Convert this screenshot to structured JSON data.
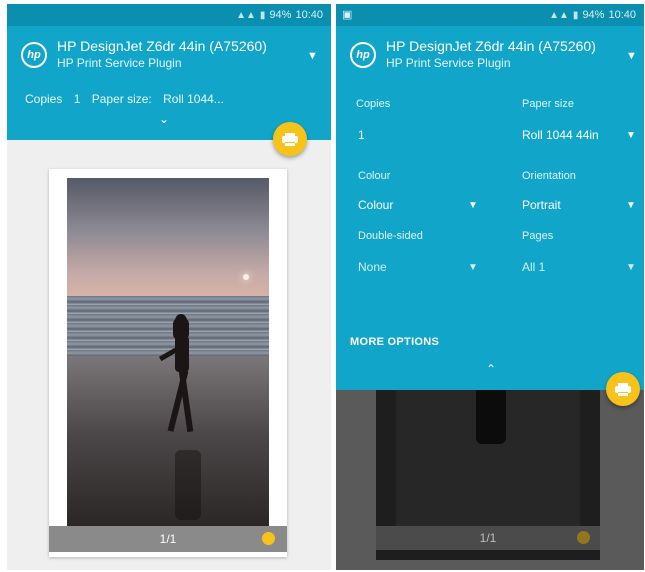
{
  "status_bar": {
    "time": "10:40",
    "battery": "94%"
  },
  "printer": {
    "name": "HP DesignJet Z6dr 44in (A75260)",
    "service": "HP Print Service Plugin",
    "logo_text": "hp"
  },
  "summary": {
    "copies_label": "Copies",
    "copies_value": "1",
    "paper_label": "Paper size:",
    "paper_value": "Roll 1044..."
  },
  "options": {
    "copies": {
      "label": "Copies",
      "value": "1"
    },
    "paper_size": {
      "label": "Paper size",
      "value": "Roll 1044 44in"
    },
    "colour": {
      "label": "Colour",
      "value": "Colour"
    },
    "orientation": {
      "label": "Orientation",
      "value": "Portrait"
    },
    "two_sided": {
      "label": "Double-sided",
      "value": "None"
    },
    "pages": {
      "label": "Pages",
      "value": "All 1"
    },
    "more_options": "MORE OPTIONS"
  },
  "preview": {
    "page_label": "1/1"
  },
  "icons": {
    "signal": "signal-icon",
    "battery": "battery-icon",
    "print": "printer-icon",
    "dropdown": "chevron-down-icon"
  },
  "colors": {
    "appbar": "#11a6c9",
    "statusbar": "#0a8fb0",
    "fab": "#f7c31b"
  }
}
